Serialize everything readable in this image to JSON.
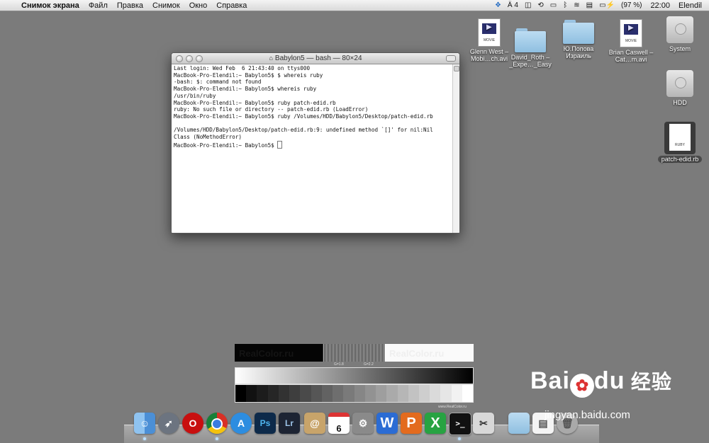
{
  "menubar": {
    "app_name": "Снимок экрана",
    "items": [
      "Файл",
      "Правка",
      "Снимок",
      "Окно",
      "Справка"
    ],
    "status": {
      "adobe_badge": "4",
      "battery": "(97 %)",
      "time": "22:00",
      "user": "Elendil"
    }
  },
  "terminal": {
    "title": "Babylon5 — bash — 80×24",
    "lines": [
      "Last login: Wed Feb  6 21:43:40 on ttys000",
      "MacBook-Pro-Elendil:~ Babylon5$ $ whereis ruby",
      "-bash: $: command not found",
      "MacBook-Pro-Elendil:~ Babylon5$ whereis ruby",
      "/usr/bin/ruby",
      "MacBook-Pro-Elendil:~ Babylon5$ ruby patch-edid.rb",
      "ruby: No such file or directory -- patch-edid.rb (LoadError)",
      "MacBook-Pro-Elendil:~ Babylon5$ ruby /Volumes/HDD/Babylon5/Desktop/patch-edid.rb",
      "",
      "/Volumes/HDD/Babylon5/Desktop/patch-edid.rb:9: undefined method `[]' for nil:Nil",
      "Class (NoMethodError)"
    ],
    "prompt": "MacBook-Pro-Elendil:~ Babylon5$ "
  },
  "desktop": {
    "movie1": {
      "label": "Glenn West – Mobi…ch.avi",
      "cap": "MOVIE"
    },
    "folder1": {
      "label": "David_Roth – _Expe…_Easy"
    },
    "folder2": {
      "label": "Ю.Попова Израиль"
    },
    "movie2": {
      "label": "Brian Caswell – Cat…m.avi",
      "cap": "MOVIE"
    },
    "system": {
      "label": "System"
    },
    "hdd": {
      "label": "HDD"
    },
    "rubyfile": {
      "label": "patch-edid.rb",
      "cap": "RUBY"
    }
  },
  "realcolor": {
    "text_left": "RealColor.ru",
    "text_right": "RealColor.ru",
    "gamma1": "G=1.8",
    "gamma2": "G=2.2",
    "source": "www.RealColor.ru"
  },
  "dock": {
    "calendar_day": "6",
    "items": [
      "finder-icon",
      "launchpad-icon",
      "opera-icon",
      "chrome-icon",
      "app-store-icon",
      "photoshop-icon",
      "lightroom-icon",
      "address-book-icon",
      "calendar-icon",
      "system-preferences-icon",
      "word-icon",
      "powerpoint-icon",
      "excel-icon",
      "terminal-icon",
      "scissors-icon",
      "folder-icon",
      "preview-icon",
      "trash-icon"
    ],
    "ps_label": "Ps",
    "lr_label": "Lr",
    "word_label": "W",
    "ppt_label": "P",
    "excel_label": "X",
    "terminal_label": ">_"
  },
  "watermark": {
    "brand_left": "Bai",
    "brand_right": "du",
    "brand_cn": "经验",
    "url": "jingyan.baidu.com"
  }
}
